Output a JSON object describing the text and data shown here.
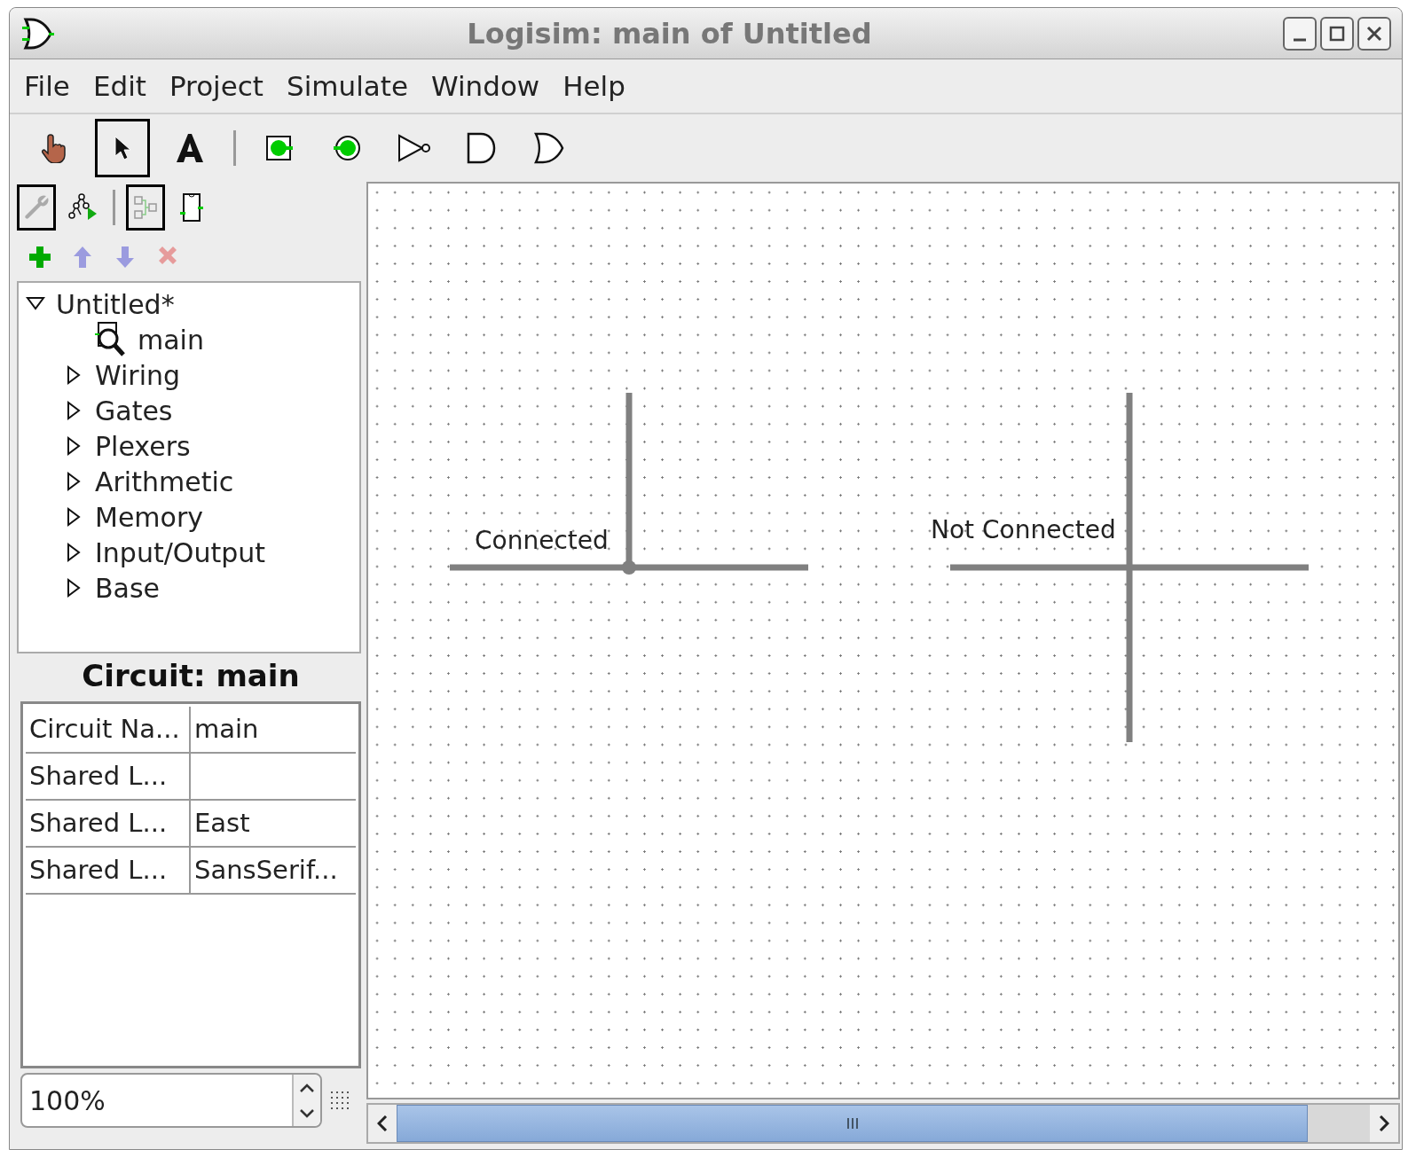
{
  "window": {
    "title": "Logisim: main of Untitled"
  },
  "menu": [
    "File",
    "Edit",
    "Project",
    "Simulate",
    "Window",
    "Help"
  ],
  "toolbar": [
    {
      "kind": "hand",
      "selected": false
    },
    {
      "kind": "arrow",
      "selected": true
    },
    {
      "kind": "text",
      "selected": false
    },
    {
      "kind": "separator"
    },
    {
      "kind": "input",
      "selected": false
    },
    {
      "kind": "output",
      "selected": false
    },
    {
      "kind": "not",
      "selected": false
    },
    {
      "kind": "and",
      "selected": false
    },
    {
      "kind": "or",
      "selected": false
    }
  ],
  "explorer_toolbar": [
    {
      "kind": "wrench",
      "selected": true
    },
    {
      "kind": "simtree",
      "selected": false
    },
    {
      "kind": "separator"
    },
    {
      "kind": "layout",
      "selected": true
    },
    {
      "kind": "appearance",
      "selected": false
    }
  ],
  "explorer_actions": [
    {
      "kind": "add",
      "disabled": false
    },
    {
      "kind": "up",
      "disabled": true
    },
    {
      "kind": "down",
      "disabled": true
    },
    {
      "kind": "delete",
      "disabled": true
    }
  ],
  "tree": [
    {
      "label": "Untitled*",
      "expanded": true,
      "children": [
        {
          "label": "main",
          "kind": "circuit"
        },
        {
          "label": "Wiring",
          "kind": "library",
          "expanded": false
        },
        {
          "label": "Gates",
          "kind": "library",
          "expanded": false
        },
        {
          "label": "Plexers",
          "kind": "library",
          "expanded": false
        },
        {
          "label": "Arithmetic",
          "kind": "library",
          "expanded": false
        },
        {
          "label": "Memory",
          "kind": "library",
          "expanded": false
        },
        {
          "label": "Input/Output",
          "kind": "library",
          "expanded": false
        },
        {
          "label": "Base",
          "kind": "library",
          "expanded": false
        }
      ]
    }
  ],
  "properties": {
    "title": "Circuit: main",
    "rows": [
      {
        "name": "Circuit Na...",
        "value": "main"
      },
      {
        "name": "Shared L..."
      },
      {
        "name": "Shared L...",
        "value": "East"
      },
      {
        "name": "Shared L...",
        "value": "SansSerif..."
      }
    ]
  },
  "zoom": {
    "value": "100%"
  },
  "canvas": {
    "crossings": [
      {
        "label": "Connected",
        "connected": true
      },
      {
        "label": "Not Connected",
        "connected": false
      }
    ]
  }
}
